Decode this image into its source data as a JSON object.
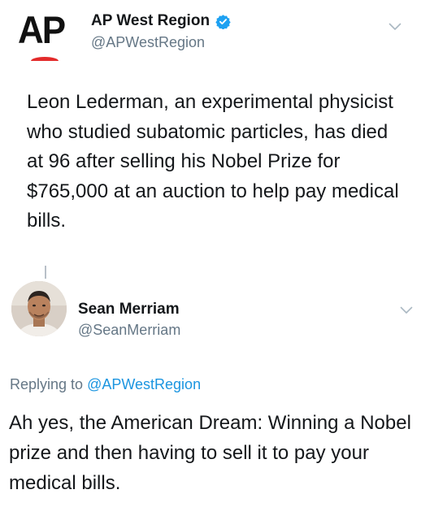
{
  "original_tweet": {
    "display_name": "AP West Region",
    "handle": "@APWestRegion",
    "logo_text": "AP",
    "verified": true,
    "text": "Leon Lederman, an experimental physicist who studied subatomic particles, has died at 96 after selling his Nobel Prize for $765,000 at an auction to help pay medical bills."
  },
  "reply_tweet": {
    "display_name": "Sean Merriam",
    "handle": "@SeanMerriam",
    "replying_to_prefix": "Replying to",
    "replying_to_handle": "@APWestRegion",
    "text": "Ah yes, the American Dream: Winning a Nobel prize and then having to sell it to pay your medical bills."
  },
  "colors": {
    "text": "#14171a",
    "secondary_text": "#657786",
    "link": "#1b95e0",
    "verified_badge": "#1da1f2",
    "ap_red": "#e32b2b"
  },
  "icons": {
    "verified": "verified-badge-icon",
    "menu": "chevron-down-icon"
  }
}
